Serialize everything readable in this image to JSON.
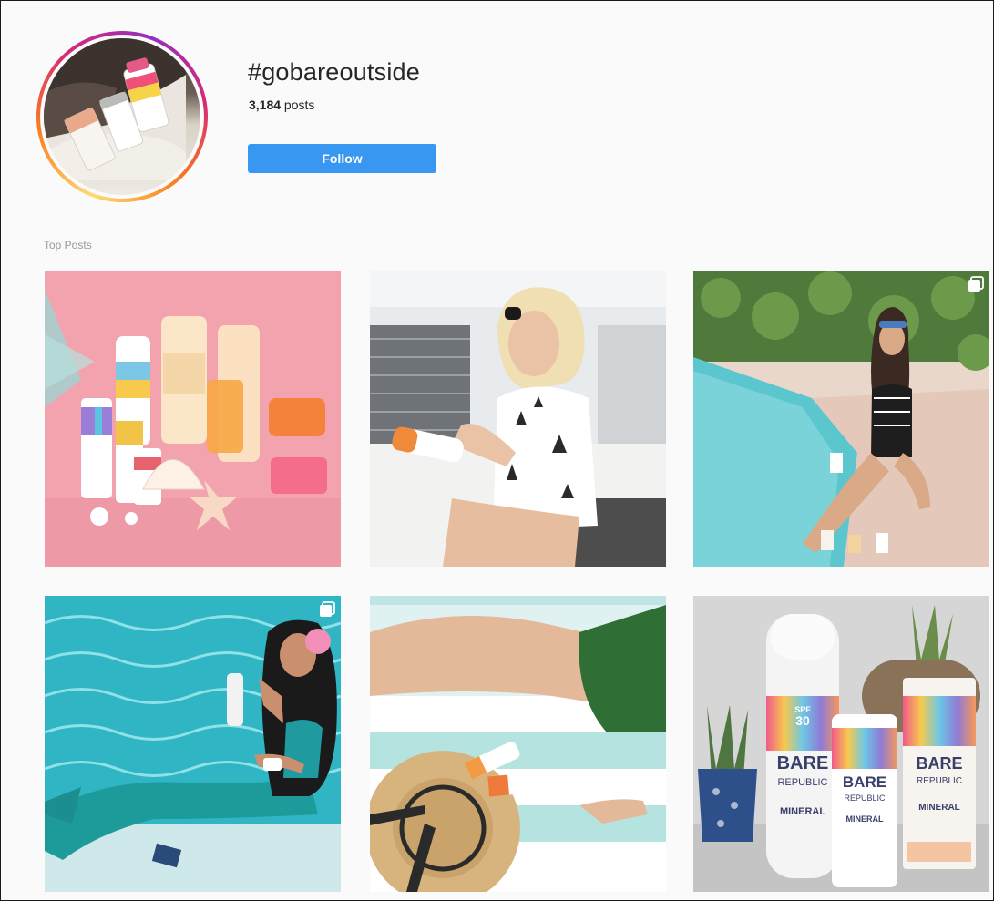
{
  "hashtag": {
    "title": "#gobareoutside",
    "post_count": "3,184",
    "post_count_suffix": " posts",
    "follow_label": "Follow",
    "avatar_icon": "hashtag-avatar-photo"
  },
  "top_posts": {
    "label": "Top Posts",
    "posts": [
      {
        "subject": "sunscreen products on pink background",
        "multi": false
      },
      {
        "subject": "woman in sunglasses holding sunscreen",
        "multi": false
      },
      {
        "subject": "woman sitting by pool with sunscreen",
        "multi": true
      },
      {
        "subject": "girl in mermaid tail by pool",
        "multi": true
      },
      {
        "subject": "legs on towel with straw hat and sunscreen",
        "multi": false
      },
      {
        "subject": "Bare Republic mineral sunscreen bottles",
        "multi": false
      }
    ],
    "product_text": {
      "brand_line1": "BARE",
      "brand_line2": "REPUBLIC",
      "mineral": "MINERAL",
      "spf": "SPF",
      "spf_value": "30"
    }
  },
  "colors": {
    "accent": "#3897f0",
    "background": "#fafafa",
    "pink": "#f2a3ad",
    "pool": "#5cc6cf"
  }
}
